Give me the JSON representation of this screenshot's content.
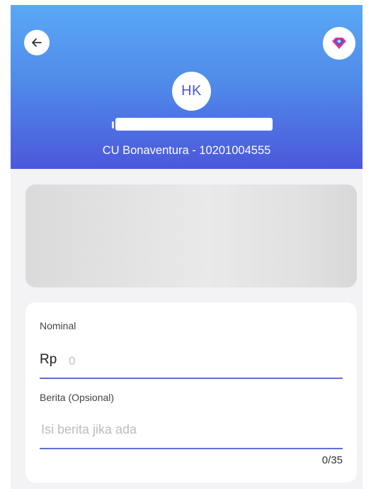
{
  "header": {
    "avatar_initials": "HK",
    "account_info": "CU Bonaventura - 10201004555"
  },
  "form": {
    "nominal_label": "Nominal",
    "currency_prefix": "Rp",
    "nominal_placeholder": "0",
    "message_label": "Berita (Opsional)",
    "message_placeholder": "Isi berita jika ada",
    "char_counter": "0/35"
  },
  "colors": {
    "header_top": "#5aa8f5",
    "header_bottom": "#4c57db",
    "accent_line": "#5b6fd3"
  },
  "icons": {
    "back": "arrow-left-icon",
    "premium": "gem-icon"
  }
}
